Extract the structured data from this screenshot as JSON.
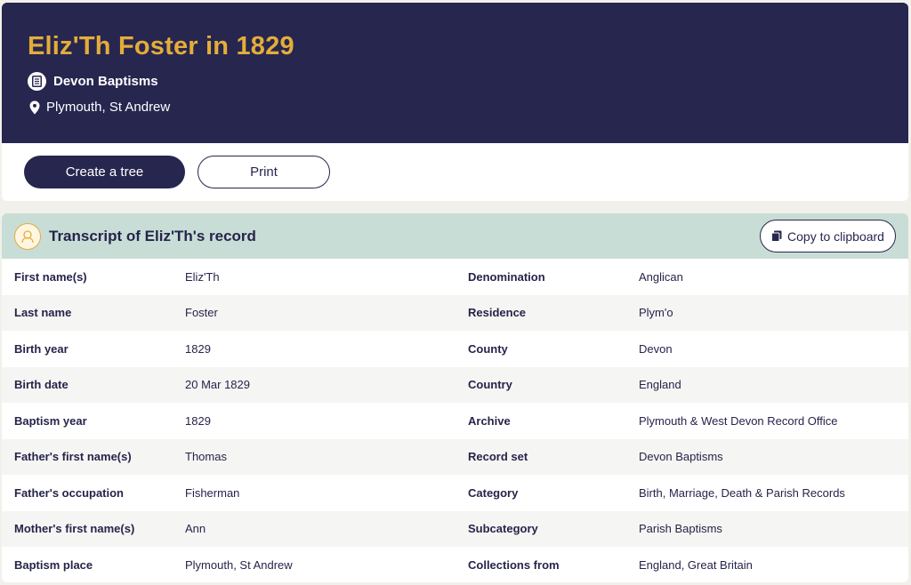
{
  "header": {
    "title": "Eliz'Th Foster in 1829",
    "record_set": "Devon Baptisms",
    "location": "Plymouth, St Andrew"
  },
  "actions": {
    "create_tree": "Create a tree",
    "print": "Print"
  },
  "transcript": {
    "title": "Transcript of Eliz'Th's record",
    "copy_label": "Copy to clipboard",
    "rows": [
      {
        "l1": "First name(s)",
        "v1": "Eliz'Th",
        "l2": "Denomination",
        "v2": "Anglican"
      },
      {
        "l1": "Last name",
        "v1": "Foster",
        "l2": "Residence",
        "v2": "Plym'o"
      },
      {
        "l1": "Birth year",
        "v1": "1829",
        "l2": "County",
        "v2": "Devon"
      },
      {
        "l1": "Birth date",
        "v1": "20 Mar 1829",
        "l2": "Country",
        "v2": "England"
      },
      {
        "l1": "Baptism year",
        "v1": "1829",
        "l2": "Archive",
        "v2": "Plymouth & West Devon Record Office"
      },
      {
        "l1": "Father's first name(s)",
        "v1": "Thomas",
        "l2": "Record set",
        "v2": "Devon Baptisms"
      },
      {
        "l1": "Father's occupation",
        "v1": "Fisherman",
        "l2": "Category",
        "v2": "Birth, Marriage, Death & Parish Records"
      },
      {
        "l1": "Mother's first name(s)",
        "v1": "Ann",
        "l2": "Subcategory",
        "v2": "Parish Baptisms"
      },
      {
        "l1": "Baptism place",
        "v1": "Plymouth, St Andrew",
        "l2": "Collections from",
        "v2": "England, Great Britain"
      }
    ]
  },
  "colors": {
    "header_bg": "#27264f",
    "title_accent": "#e3ad3a",
    "transcript_header_bg": "#c8ddd6"
  },
  "icons": {
    "record_set": "document-icon",
    "location": "map-pin-icon",
    "transcript": "person-avatar-icon",
    "copy": "copy-icon"
  }
}
